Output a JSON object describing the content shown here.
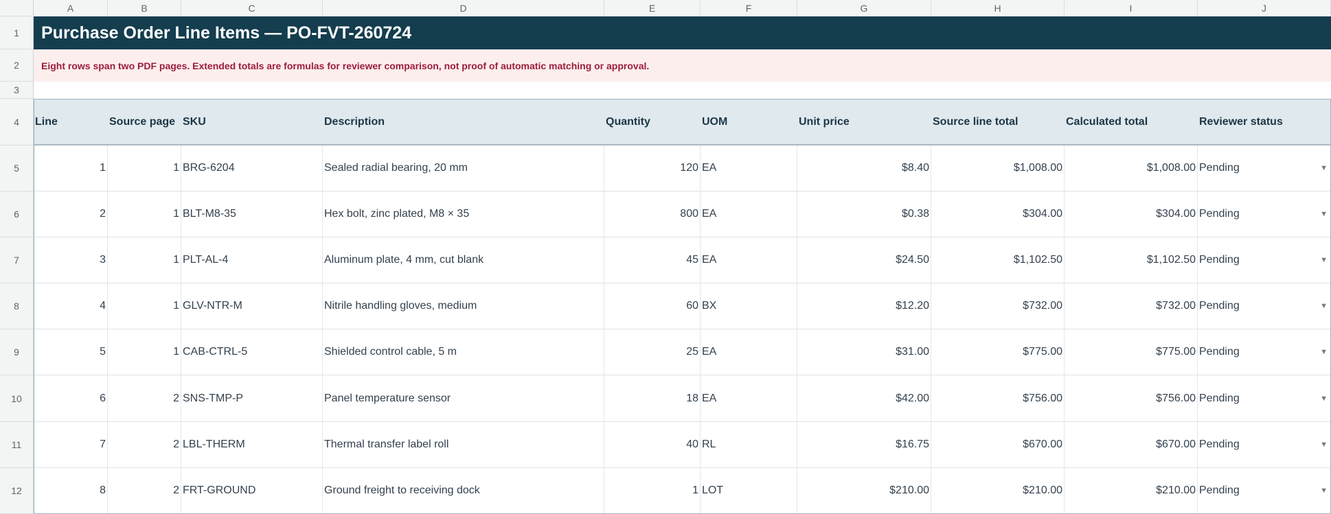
{
  "columns": [
    "A",
    "B",
    "C",
    "D",
    "E",
    "F",
    "G",
    "H",
    "I",
    "J"
  ],
  "rows": [
    "1",
    "2",
    "3",
    "4",
    "5",
    "6",
    "7",
    "8",
    "9",
    "10",
    "11",
    "12"
  ],
  "title": "Purchase Order Line Items — PO-FVT-260724",
  "note": "Eight rows span two PDF pages. Extended totals are formulas for reviewer comparison, not proof of automatic matching or approval.",
  "headers": [
    "Line",
    "Source page",
    "SKU",
    "Description",
    "Quantity",
    "UOM",
    "Unit price",
    "Source line total",
    "Calculated total",
    "Reviewer status"
  ],
  "items": [
    {
      "line": "1",
      "page": "1",
      "sku": "BRG-6204",
      "desc": "Sealed radial bearing, 20 mm",
      "qty": "120",
      "uom": "EA",
      "price": "$8.40",
      "src_total": "$1,008.00",
      "calc_total": "$1,008.00",
      "status": "Pending"
    },
    {
      "line": "2",
      "page": "1",
      "sku": "BLT-M8-35",
      "desc": "Hex bolt, zinc plated, M8 × 35",
      "qty": "800",
      "uom": "EA",
      "price": "$0.38",
      "src_total": "$304.00",
      "calc_total": "$304.00",
      "status": "Pending"
    },
    {
      "line": "3",
      "page": "1",
      "sku": "PLT-AL-4",
      "desc": "Aluminum plate, 4 mm, cut blank",
      "qty": "45",
      "uom": "EA",
      "price": "$24.50",
      "src_total": "$1,102.50",
      "calc_total": "$1,102.50",
      "status": "Pending"
    },
    {
      "line": "4",
      "page": "1",
      "sku": "GLV-NTR-M",
      "desc": "Nitrile handling gloves, medium",
      "qty": "60",
      "uom": "BX",
      "price": "$12.20",
      "src_total": "$732.00",
      "calc_total": "$732.00",
      "status": "Pending"
    },
    {
      "line": "5",
      "page": "1",
      "sku": "CAB-CTRL-5",
      "desc": "Shielded control cable, 5 m",
      "qty": "25",
      "uom": "EA",
      "price": "$31.00",
      "src_total": "$775.00",
      "calc_total": "$775.00",
      "status": "Pending"
    },
    {
      "line": "6",
      "page": "2",
      "sku": "SNS-TMP-P",
      "desc": "Panel temperature sensor",
      "qty": "18",
      "uom": "EA",
      "price": "$42.00",
      "src_total": "$756.00",
      "calc_total": "$756.00",
      "status": "Pending"
    },
    {
      "line": "7",
      "page": "2",
      "sku": "LBL-THERM",
      "desc": "Thermal transfer label roll",
      "qty": "40",
      "uom": "RL",
      "price": "$16.75",
      "src_total": "$670.00",
      "calc_total": "$670.00",
      "status": "Pending"
    },
    {
      "line": "8",
      "page": "2",
      "sku": "FRT-GROUND",
      "desc": "Ground freight to receiving dock",
      "qty": "1",
      "uom": "LOT",
      "price": "$210.00",
      "src_total": "$210.00",
      "calc_total": "$210.00",
      "status": "Pending"
    }
  ],
  "icons": {
    "status_dropdown": "chevron-down-icon"
  },
  "colors": {
    "title_bg": "#143d4e",
    "note_bg": "#fdeeee",
    "note_text": "#9b1d3b",
    "header_bg": "#dfe9ee"
  }
}
